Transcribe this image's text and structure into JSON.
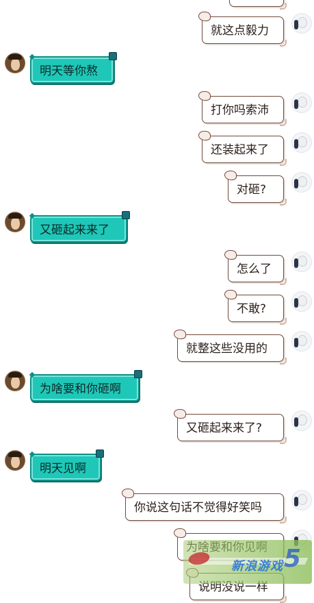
{
  "messages": [
    {
      "side": "me",
      "text": "就这点毅力"
    },
    {
      "side": "other",
      "text": "明天等你熬"
    },
    {
      "side": "me",
      "text": "打你吗索沛"
    },
    {
      "side": "me",
      "text": "还装起来了"
    },
    {
      "side": "me",
      "text": "对砸?"
    },
    {
      "side": "other",
      "text": "又砸起来来了"
    },
    {
      "side": "me",
      "text": "怎么了"
    },
    {
      "side": "me",
      "text": "不敢?"
    },
    {
      "side": "me",
      "text": "就整这些没用的"
    },
    {
      "side": "other",
      "text": "为啥要和你砸啊"
    },
    {
      "side": "me",
      "text": "又砸起来来了?"
    },
    {
      "side": "other",
      "text": "明天见啊"
    },
    {
      "side": "me",
      "text": "你说这句话不觉得好笑吗"
    },
    {
      "side": "me",
      "text": "为啥要和你见啊"
    },
    {
      "side": "me",
      "text": "说明没说一样"
    }
  ],
  "watermark": {
    "brand_text": "新浪游戏",
    "number": "5"
  },
  "colors": {
    "my_bubble_border": "#6e4a3a",
    "other_bubble_fill": "#1fc7b8",
    "other_bubble_border": "#0e8f86"
  }
}
